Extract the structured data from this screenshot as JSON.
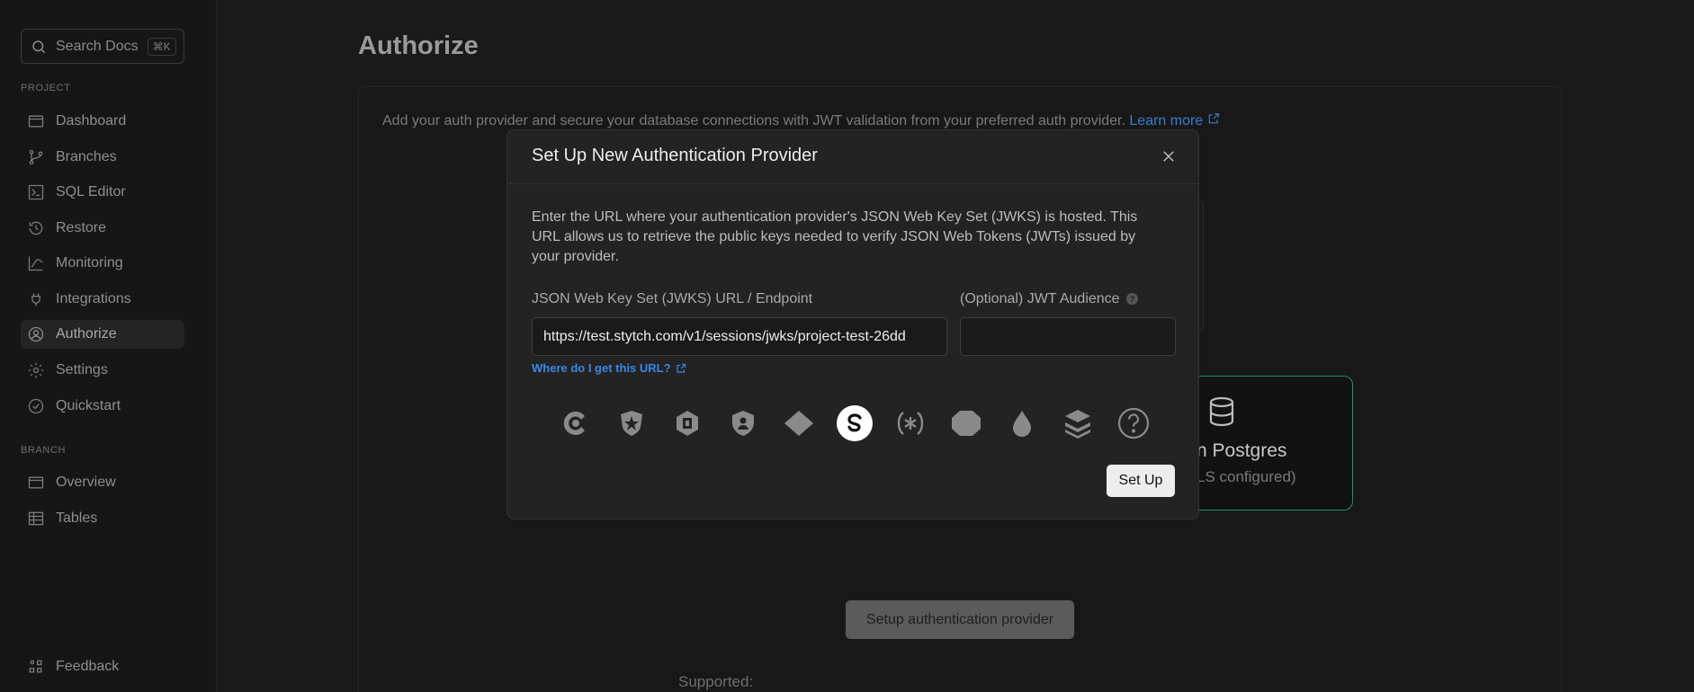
{
  "sidebar": {
    "search": {
      "label": "Search Docs",
      "shortcut": "⌘K"
    },
    "project_section": "PROJECT",
    "project_items": [
      {
        "label": "Dashboard",
        "icon": "dashboard-icon"
      },
      {
        "label": "Branches",
        "icon": "branches-icon"
      },
      {
        "label": "SQL Editor",
        "icon": "sql-editor-icon"
      },
      {
        "label": "Restore",
        "icon": "restore-icon"
      },
      {
        "label": "Monitoring",
        "icon": "monitoring-icon"
      },
      {
        "label": "Integrations",
        "icon": "integrations-icon"
      },
      {
        "label": "Authorize",
        "icon": "authorize-icon",
        "active": true
      },
      {
        "label": "Settings",
        "icon": "settings-icon"
      },
      {
        "label": "Quickstart",
        "icon": "quickstart-icon"
      }
    ],
    "branch_section": "BRANCH",
    "branch_items": [
      {
        "label": "Overview",
        "icon": "overview-icon"
      },
      {
        "label": "Tables",
        "icon": "tables-icon"
      }
    ],
    "feedback": "Feedback"
  },
  "main": {
    "title": "Authorize",
    "description": "Add your auth provider and secure your database connections with JWT validation from your preferred auth provider.",
    "learn_more": "Learn more",
    "card_title": "n Postgres",
    "card_subtitle": "LS configured)",
    "setup_button": "Setup authentication provider",
    "supported_label": "Supported:"
  },
  "modal": {
    "title": "Set Up New Authentication Provider",
    "description": "Enter the URL where your authentication provider's JSON Web Key Set (JWKS) is hosted. This URL allows us to retrieve the public keys needed to verify JSON Web Tokens (JWTs) issued by your provider.",
    "jwks_label": "JSON Web Key Set (JWKS) URL / Endpoint",
    "jwks_value": "https://test.stytch.com/v1/sessions/jwks/project-test-26dd",
    "audience_label": "(Optional) JWT Audience",
    "audience_value": "",
    "help_glyph": "?",
    "where_link": "Where do I get this URL?",
    "providers": [
      {
        "name": "clerk",
        "icon": "clerk-icon",
        "selected": false
      },
      {
        "name": "auth0",
        "icon": "auth0-icon",
        "selected": false
      },
      {
        "name": "descope",
        "icon": "descope-icon",
        "selected": false
      },
      {
        "name": "keycloak",
        "icon": "keycloak-icon",
        "selected": false
      },
      {
        "name": "diamond",
        "icon": "diamond-icon",
        "selected": false
      },
      {
        "name": "stytch",
        "icon": "stytch-icon",
        "selected": true
      },
      {
        "name": "asterisk",
        "icon": "asterisk-icon",
        "selected": false
      },
      {
        "name": "octagon",
        "icon": "octagon-icon",
        "selected": false
      },
      {
        "name": "drop",
        "icon": "drop-icon",
        "selected": false
      },
      {
        "name": "layers",
        "icon": "layers-icon",
        "selected": false
      },
      {
        "name": "other",
        "icon": "question-icon",
        "selected": false
      }
    ],
    "setup_label": "Set Up"
  },
  "colors": {
    "accent_link": "#3b86e6",
    "card_border": "#1f8f72",
    "background": "#1a1a1a"
  }
}
